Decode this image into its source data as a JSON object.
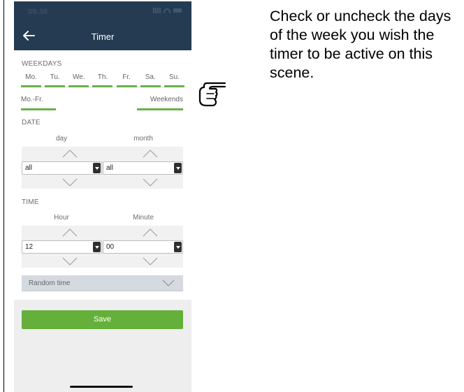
{
  "statusbar": {
    "time": "09:38"
  },
  "appbar": {
    "title": "Timer"
  },
  "weekdays": {
    "label": "WEEKDAYS",
    "days": [
      "Mo.",
      "Tu.",
      "We.",
      "Th.",
      "Fr.",
      "Sa.",
      "Su."
    ],
    "preset_weekdays": "Mo.-Fr.",
    "preset_weekends": "Weekends"
  },
  "date": {
    "label": "DATE",
    "day_label": "day",
    "month_label": "month",
    "day_value": "all",
    "month_value": "all"
  },
  "time": {
    "label": "TIME",
    "hour_label": "Hour",
    "minute_label": "Minute",
    "hour_value": "12",
    "minute_value": "00"
  },
  "random_time": {
    "label": "Random time"
  },
  "save_label": "Save",
  "instruction": "Check or uncheck the days of the week you wish the timer to be active on this scene.",
  "colors": {
    "header": "#243b52",
    "accent_green": "#65b03a",
    "underline_green": "#6ab04c"
  },
  "icons": {
    "back": "arrow-left-icon",
    "chevron_up": "chevron-up-icon",
    "chevron_down": "chevron-down-icon",
    "pointer": "pointing-hand-icon"
  }
}
